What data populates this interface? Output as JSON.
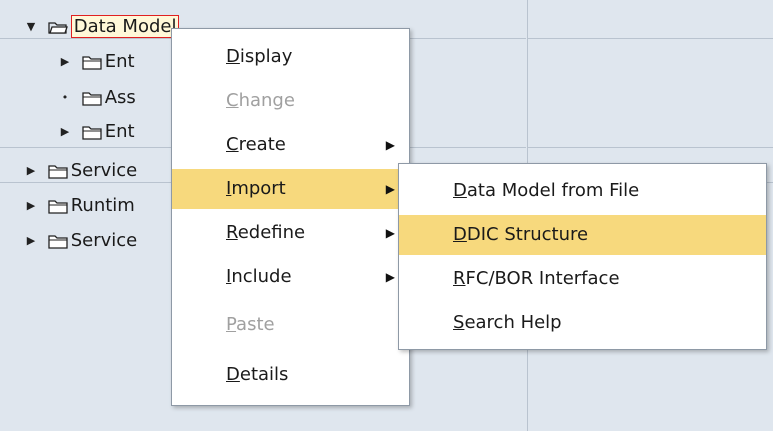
{
  "tree": {
    "root": {
      "toggle": "▼",
      "label": "Data Model"
    },
    "children": [
      {
        "toggle": "▶",
        "label": "Ent"
      },
      {
        "toggle": "•",
        "label": "Ass"
      },
      {
        "toggle": "▶",
        "label": "Ent"
      }
    ],
    "top_level": [
      {
        "toggle": "▶",
        "label": "Service"
      },
      {
        "toggle": "▶",
        "label": "Runtim"
      },
      {
        "toggle": "▶",
        "label": "Service"
      }
    ]
  },
  "context_menu": {
    "items": [
      {
        "mnemonic": "D",
        "rest": "isplay",
        "enabled": true,
        "submenu": false
      },
      {
        "mnemonic": "C",
        "rest": "hange",
        "enabled": false,
        "submenu": false
      },
      {
        "mnemonic": "C",
        "rest": "reate",
        "enabled": true,
        "submenu": true,
        "arrow": "▶"
      },
      {
        "mnemonic": "I",
        "rest": "mport",
        "enabled": true,
        "submenu": true,
        "arrow": "▶",
        "highlighted": true
      },
      {
        "mnemonic": "R",
        "rest": "edefine",
        "enabled": true,
        "submenu": true,
        "arrow": "▶"
      },
      {
        "mnemonic": "I",
        "rest": "nclude",
        "enabled": true,
        "submenu": true,
        "arrow": "▶"
      },
      {
        "mnemonic": "P",
        "rest": "aste",
        "enabled": false,
        "submenu": false
      },
      {
        "mnemonic": "D",
        "rest": "etails",
        "enabled": true,
        "submenu": false
      }
    ]
  },
  "import_submenu": {
    "items": [
      {
        "mnemonic": "D",
        "rest": "ata Model from File"
      },
      {
        "mnemonic": "D",
        "rest": "DIC Structure",
        "highlighted": true
      },
      {
        "mnemonic": "R",
        "rest": "FC/BOR Interface"
      },
      {
        "mnemonic": "S",
        "rest": "earch Help"
      }
    ]
  },
  "colors": {
    "highlight": "#f7d97d",
    "selection_border": "#e02020",
    "background": "#dfe6ee"
  }
}
